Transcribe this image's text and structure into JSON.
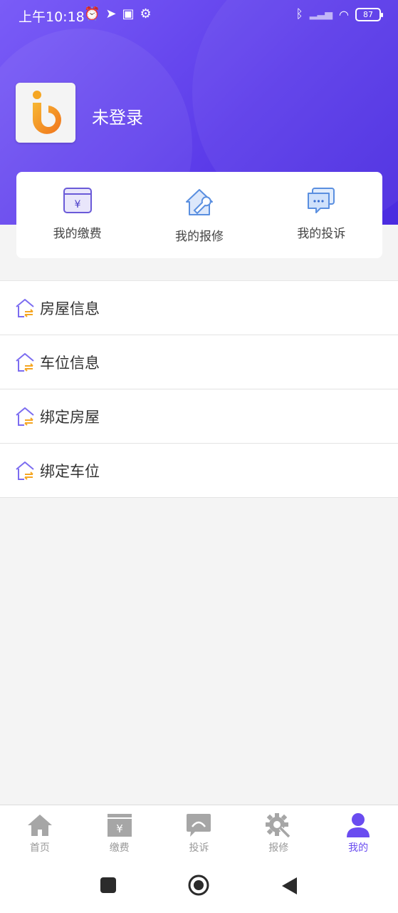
{
  "status_bar": {
    "time": "上午10:18",
    "battery": "87"
  },
  "profile": {
    "login_status": "未登录"
  },
  "quick_actions": [
    {
      "label": "我的缴费",
      "icon": "bill-icon"
    },
    {
      "label": "我的报修",
      "icon": "house-repair-icon"
    },
    {
      "label": "我的投诉",
      "icon": "chat-bubble-icon"
    }
  ],
  "menu": [
    {
      "label": "房屋信息",
      "icon": "house-switch-icon"
    },
    {
      "label": "车位信息",
      "icon": "house-switch-icon"
    },
    {
      "label": "绑定房屋",
      "icon": "house-switch-icon"
    },
    {
      "label": "绑定车位",
      "icon": "house-switch-icon"
    }
  ],
  "tabs": [
    {
      "label": "首页",
      "icon": "home-icon",
      "active": false
    },
    {
      "label": "缴费",
      "icon": "payment-icon",
      "active": false
    },
    {
      "label": "投诉",
      "icon": "complaint-icon",
      "active": false
    },
    {
      "label": "报修",
      "icon": "repair-gear-icon",
      "active": false
    },
    {
      "label": "我的",
      "icon": "user-icon",
      "active": true
    }
  ],
  "colors": {
    "primary": "#6a4cf0",
    "header_start": "#7a5cf7",
    "header_end": "#4a2be0",
    "accent_orange": "#f5a623"
  }
}
